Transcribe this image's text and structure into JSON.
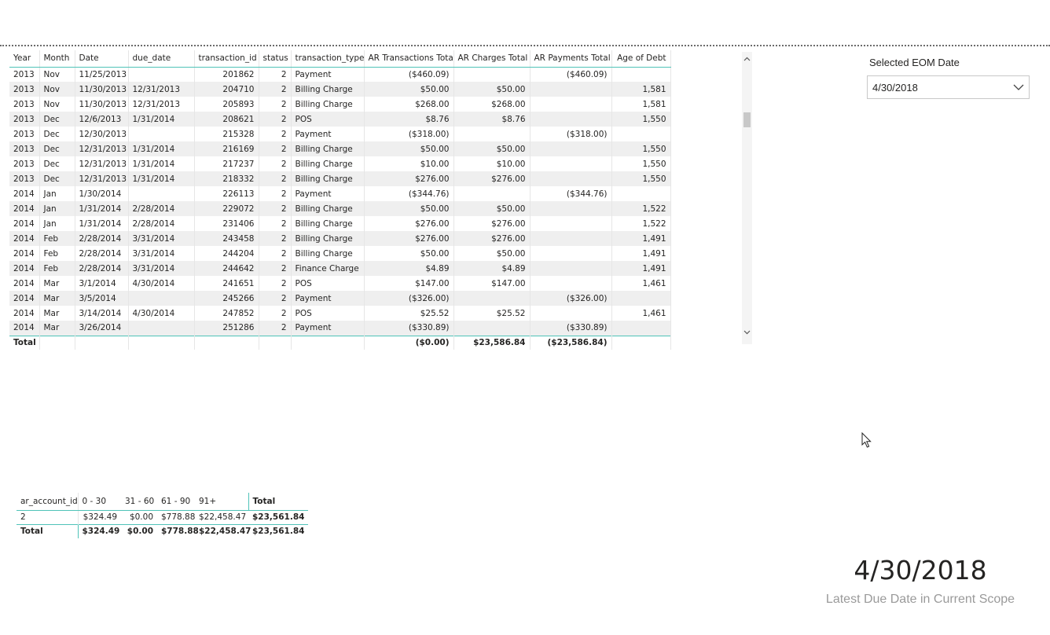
{
  "transactions": {
    "columns": [
      "Year",
      "Month",
      "Date",
      "due_date",
      "transaction_id",
      "status",
      "transaction_type",
      "AR Transactions Total",
      "AR Charges Total",
      "AR Payments Total",
      "Age of Debt"
    ],
    "rows": [
      [
        "2013",
        "Nov",
        "11/25/2013",
        "",
        "201862",
        "2",
        "Payment",
        "($460.09)",
        "",
        "($460.09)",
        ""
      ],
      [
        "2013",
        "Nov",
        "11/30/2013",
        "12/31/2013",
        "204710",
        "2",
        "Billing Charge",
        "$50.00",
        "$50.00",
        "",
        "1,581"
      ],
      [
        "2013",
        "Nov",
        "11/30/2013",
        "12/31/2013",
        "205893",
        "2",
        "Billing Charge",
        "$268.00",
        "$268.00",
        "",
        "1,581"
      ],
      [
        "2013",
        "Dec",
        "12/6/2013",
        "1/31/2014",
        "208621",
        "2",
        "POS",
        "$8.76",
        "$8.76",
        "",
        "1,550"
      ],
      [
        "2013",
        "Dec",
        "12/30/2013",
        "",
        "215328",
        "2",
        "Payment",
        "($318.00)",
        "",
        "($318.00)",
        ""
      ],
      [
        "2013",
        "Dec",
        "12/31/2013",
        "1/31/2014",
        "216169",
        "2",
        "Billing Charge",
        "$50.00",
        "$50.00",
        "",
        "1,550"
      ],
      [
        "2013",
        "Dec",
        "12/31/2013",
        "1/31/2014",
        "217237",
        "2",
        "Billing Charge",
        "$10.00",
        "$10.00",
        "",
        "1,550"
      ],
      [
        "2013",
        "Dec",
        "12/31/2013",
        "1/31/2014",
        "218332",
        "2",
        "Billing Charge",
        "$276.00",
        "$276.00",
        "",
        "1,550"
      ],
      [
        "2014",
        "Jan",
        "1/30/2014",
        "",
        "226113",
        "2",
        "Payment",
        "($344.76)",
        "",
        "($344.76)",
        ""
      ],
      [
        "2014",
        "Jan",
        "1/31/2014",
        "2/28/2014",
        "229072",
        "2",
        "Billing Charge",
        "$50.00",
        "$50.00",
        "",
        "1,522"
      ],
      [
        "2014",
        "Jan",
        "1/31/2014",
        "2/28/2014",
        "231406",
        "2",
        "Billing Charge",
        "$276.00",
        "$276.00",
        "",
        "1,522"
      ],
      [
        "2014",
        "Feb",
        "2/28/2014",
        "3/31/2014",
        "243458",
        "2",
        "Billing Charge",
        "$276.00",
        "$276.00",
        "",
        "1,491"
      ],
      [
        "2014",
        "Feb",
        "2/28/2014",
        "3/31/2014",
        "244204",
        "2",
        "Billing Charge",
        "$50.00",
        "$50.00",
        "",
        "1,491"
      ],
      [
        "2014",
        "Feb",
        "2/28/2014",
        "3/31/2014",
        "244642",
        "2",
        "Finance Charge",
        "$4.89",
        "$4.89",
        "",
        "1,491"
      ],
      [
        "2014",
        "Mar",
        "3/1/2014",
        "4/30/2014",
        "241651",
        "2",
        "POS",
        "$147.00",
        "$147.00",
        "",
        "1,461"
      ],
      [
        "2014",
        "Mar",
        "3/5/2014",
        "",
        "245266",
        "2",
        "Payment",
        "($326.00)",
        "",
        "($326.00)",
        ""
      ],
      [
        "2014",
        "Mar",
        "3/14/2014",
        "4/30/2014",
        "247852",
        "2",
        "POS",
        "$25.52",
        "$25.52",
        "",
        "1,461"
      ],
      [
        "2014",
        "Mar",
        "3/26/2014",
        "",
        "251286",
        "2",
        "Payment",
        "($330.89)",
        "",
        "($330.89)",
        ""
      ]
    ],
    "total_row": [
      "Total",
      "",
      "",
      "",
      "",
      "",
      "",
      "($0.00)",
      "$23,586.84",
      "($23,586.84)",
      ""
    ]
  },
  "scrollbar": {
    "up_icon": "chevron-up-icon",
    "down_icon": "chevron-down-icon"
  },
  "slicer": {
    "title": "Selected EOM Date",
    "selected": "4/30/2018",
    "icon": "chevron-down-icon"
  },
  "aging": {
    "columns": [
      "ar_account_id",
      "0 - 30",
      "31 - 60",
      "61 - 90",
      "91+",
      "Total"
    ],
    "rows": [
      [
        "2",
        "$324.49",
        "$0.00",
        "$778.88",
        "$22,458.47",
        "$23,561.84"
      ]
    ],
    "total_row": [
      "Total",
      "$324.49",
      "$0.00",
      "$778.88",
      "$22,458.47",
      "$23,561.84"
    ]
  },
  "card": {
    "value": "4/30/2018",
    "label": "Latest Due Date in Current Scope"
  }
}
